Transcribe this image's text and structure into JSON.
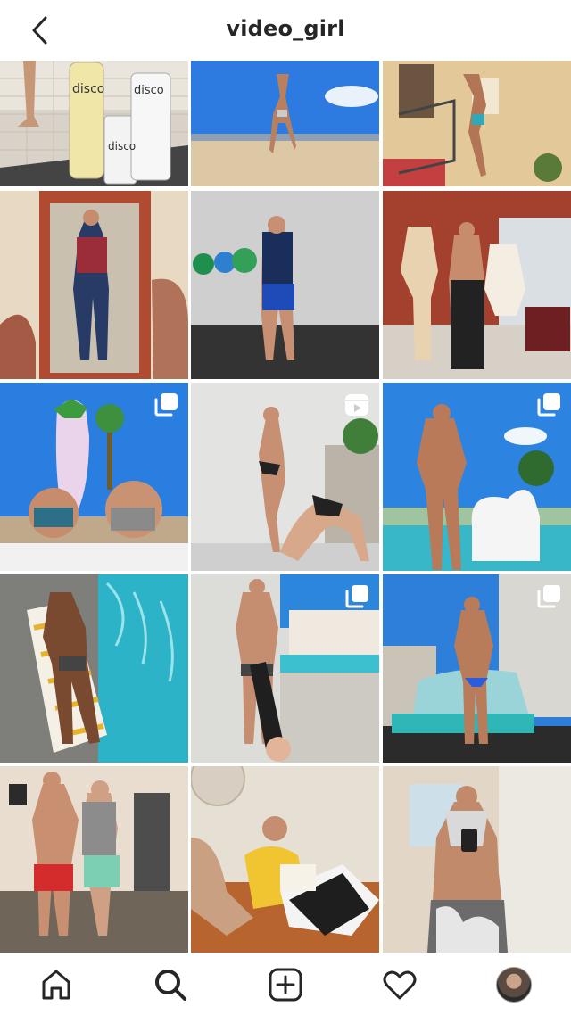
{
  "header": {
    "title": "video_girl",
    "back_icon": "chevron-left-icon"
  },
  "grid": {
    "tiles": [
      {
        "type": "photo",
        "icon": null
      },
      {
        "type": "photo",
        "icon": null
      },
      {
        "type": "photo",
        "icon": null
      },
      {
        "type": "photo",
        "icon": null
      },
      {
        "type": "photo",
        "icon": null
      },
      {
        "type": "photo",
        "icon": null
      },
      {
        "type": "carousel",
        "icon": "carousel-icon"
      },
      {
        "type": "reel",
        "icon": "reel-icon"
      },
      {
        "type": "carousel",
        "icon": "carousel-icon"
      },
      {
        "type": "photo",
        "icon": null
      },
      {
        "type": "carousel",
        "icon": "carousel-icon"
      },
      {
        "type": "carousel",
        "icon": "carousel-icon"
      },
      {
        "type": "photo",
        "icon": null
      },
      {
        "type": "photo",
        "icon": null
      },
      {
        "type": "photo",
        "icon": null
      }
    ],
    "labels": {
      "disco_1": "disco",
      "disco_2": "disco",
      "disco_3": "disco"
    }
  },
  "bottom_nav": {
    "items": [
      "home-icon",
      "search-icon",
      "new-post-icon",
      "activity-icon",
      "profile-avatar"
    ]
  },
  "colors": {
    "text": "#262626",
    "divider": "#dbdbdb",
    "background": "#ffffff"
  }
}
